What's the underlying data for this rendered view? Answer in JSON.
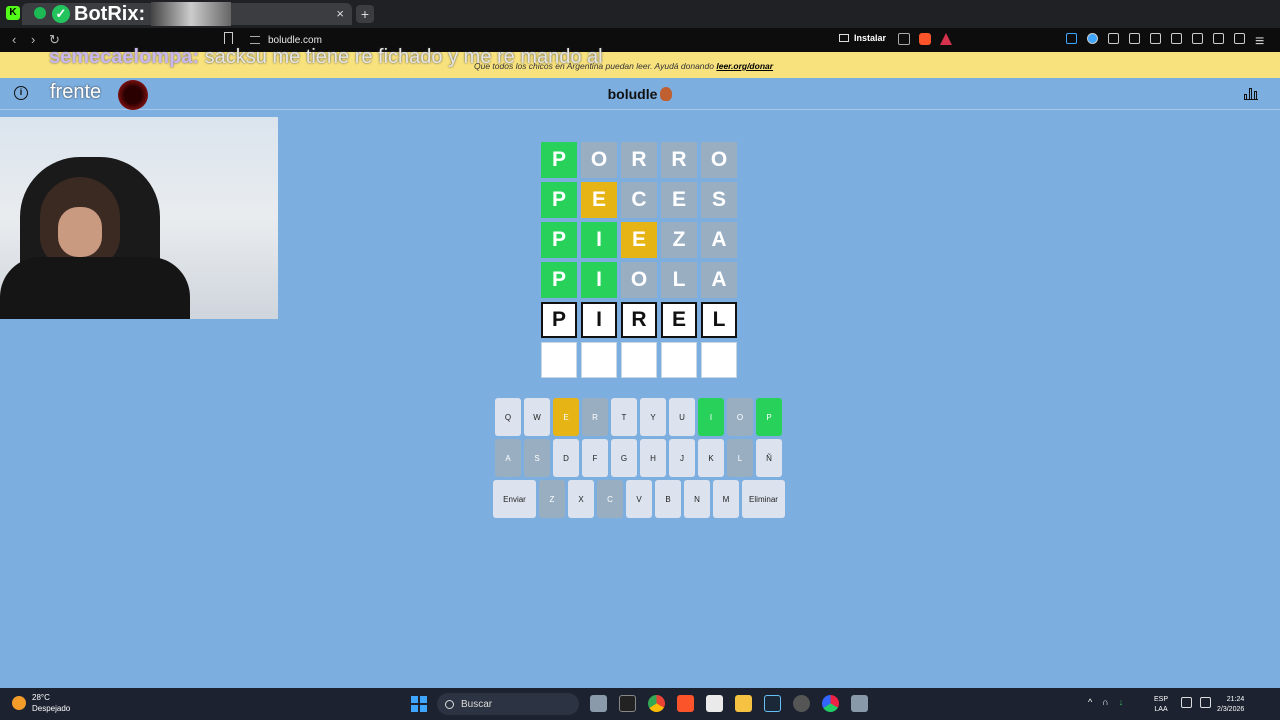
{
  "browser": {
    "botrix_label": "BotRix:",
    "url": "boludle.com",
    "install_label": "Instalar",
    "close_tab": "×",
    "new_tab": "+",
    "back": "‹",
    "forward": "›",
    "reload": "↻"
  },
  "stream_overlay": {
    "chat_user": "semecaelompa:",
    "chat_message": "sacksu me tiene re fichado y me re mando al",
    "caption": "frente"
  },
  "banner": {
    "text": "Que todos los chicos en Argentina puedan leer. Ayudá donando",
    "link": "leer.org/donar"
  },
  "game": {
    "title": "boludle",
    "info_icon": "i",
    "board": [
      [
        {
          "l": "P",
          "s": "green"
        },
        {
          "l": "O",
          "s": "gray"
        },
        {
          "l": "R",
          "s": "gray"
        },
        {
          "l": "R",
          "s": "gray"
        },
        {
          "l": "O",
          "s": "gray"
        }
      ],
      [
        {
          "l": "P",
          "s": "green"
        },
        {
          "l": "E",
          "s": "yellow"
        },
        {
          "l": "C",
          "s": "gray"
        },
        {
          "l": "E",
          "s": "gray"
        },
        {
          "l": "S",
          "s": "gray"
        }
      ],
      [
        {
          "l": "P",
          "s": "green"
        },
        {
          "l": "I",
          "s": "green"
        },
        {
          "l": "E",
          "s": "yellow"
        },
        {
          "l": "Z",
          "s": "gray"
        },
        {
          "l": "A",
          "s": "gray"
        }
      ],
      [
        {
          "l": "P",
          "s": "green"
        },
        {
          "l": "I",
          "s": "green"
        },
        {
          "l": "O",
          "s": "gray"
        },
        {
          "l": "L",
          "s": "gray"
        },
        {
          "l": "A",
          "s": "gray"
        }
      ],
      [
        {
          "l": "P",
          "s": "active"
        },
        {
          "l": "I",
          "s": "active"
        },
        {
          "l": "R",
          "s": "active"
        },
        {
          "l": "E",
          "s": "active"
        },
        {
          "l": "L",
          "s": "active"
        }
      ],
      [
        {
          "l": "",
          "s": "empty"
        },
        {
          "l": "",
          "s": "empty"
        },
        {
          "l": "",
          "s": "empty"
        },
        {
          "l": "",
          "s": "empty"
        },
        {
          "l": "",
          "s": "empty"
        }
      ]
    ],
    "keyboard": [
      [
        {
          "k": "Q",
          "s": ""
        },
        {
          "k": "W",
          "s": ""
        },
        {
          "k": "E",
          "s": "yellow"
        },
        {
          "k": "R",
          "s": "gray"
        },
        {
          "k": "T",
          "s": ""
        },
        {
          "k": "Y",
          "s": ""
        },
        {
          "k": "U",
          "s": ""
        },
        {
          "k": "I",
          "s": "green"
        },
        {
          "k": "O",
          "s": "gray"
        },
        {
          "k": "P",
          "s": "green"
        }
      ],
      [
        {
          "k": "A",
          "s": "gray"
        },
        {
          "k": "S",
          "s": "gray"
        },
        {
          "k": "D",
          "s": ""
        },
        {
          "k": "F",
          "s": ""
        },
        {
          "k": "G",
          "s": ""
        },
        {
          "k": "H",
          "s": ""
        },
        {
          "k": "J",
          "s": ""
        },
        {
          "k": "K",
          "s": ""
        },
        {
          "k": "L",
          "s": "gray"
        },
        {
          "k": "Ñ",
          "s": ""
        }
      ],
      [
        {
          "k": "Enviar",
          "s": "",
          "wide": true
        },
        {
          "k": "Z",
          "s": "gray"
        },
        {
          "k": "X",
          "s": ""
        },
        {
          "k": "C",
          "s": "gray"
        },
        {
          "k": "V",
          "s": ""
        },
        {
          "k": "B",
          "s": ""
        },
        {
          "k": "N",
          "s": ""
        },
        {
          "k": "M",
          "s": ""
        },
        {
          "k": "Eliminar",
          "s": "",
          "wide": true
        }
      ]
    ]
  },
  "taskbar": {
    "temperature": "28°C",
    "weather": "Despejado",
    "search_placeholder": "Buscar",
    "lang_1": "ESP",
    "lang_2": "LAA",
    "time": "21:24",
    "date": "2/3/2026"
  },
  "colors": {
    "page_bg": "#7daee0",
    "green": "#27d15a",
    "yellow": "#e6b414",
    "gray": "#9aaec2"
  }
}
